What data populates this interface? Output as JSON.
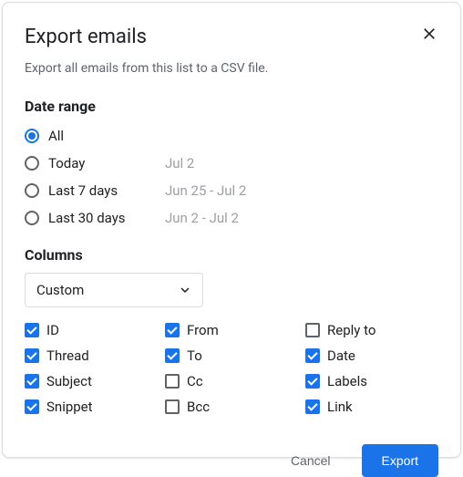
{
  "dialog": {
    "title": "Export emails",
    "subtitle": "Export all emails from this list to a CSV file."
  },
  "date_range": {
    "heading": "Date range",
    "options": [
      {
        "label": "All",
        "hint": "",
        "selected": true
      },
      {
        "label": "Today",
        "hint": "Jul 2",
        "selected": false
      },
      {
        "label": "Last 7 days",
        "hint": "Jun 25 - Jul 2",
        "selected": false
      },
      {
        "label": "Last 30 days",
        "hint": "Jun 2 - Jul 2",
        "selected": false
      }
    ]
  },
  "columns": {
    "heading": "Columns",
    "select_value": "Custom",
    "groups": [
      [
        {
          "label": "ID",
          "checked": true
        },
        {
          "label": "Thread",
          "checked": true
        },
        {
          "label": "Subject",
          "checked": true
        },
        {
          "label": "Snippet",
          "checked": true
        }
      ],
      [
        {
          "label": "From",
          "checked": true
        },
        {
          "label": "To",
          "checked": true
        },
        {
          "label": "Cc",
          "checked": false
        },
        {
          "label": "Bcc",
          "checked": false
        }
      ],
      [
        {
          "label": "Reply to",
          "checked": false
        },
        {
          "label": "Date",
          "checked": true
        },
        {
          "label": "Labels",
          "checked": true
        },
        {
          "label": "Link",
          "checked": true
        }
      ]
    ]
  },
  "footer": {
    "cancel": "Cancel",
    "export": "Export"
  }
}
